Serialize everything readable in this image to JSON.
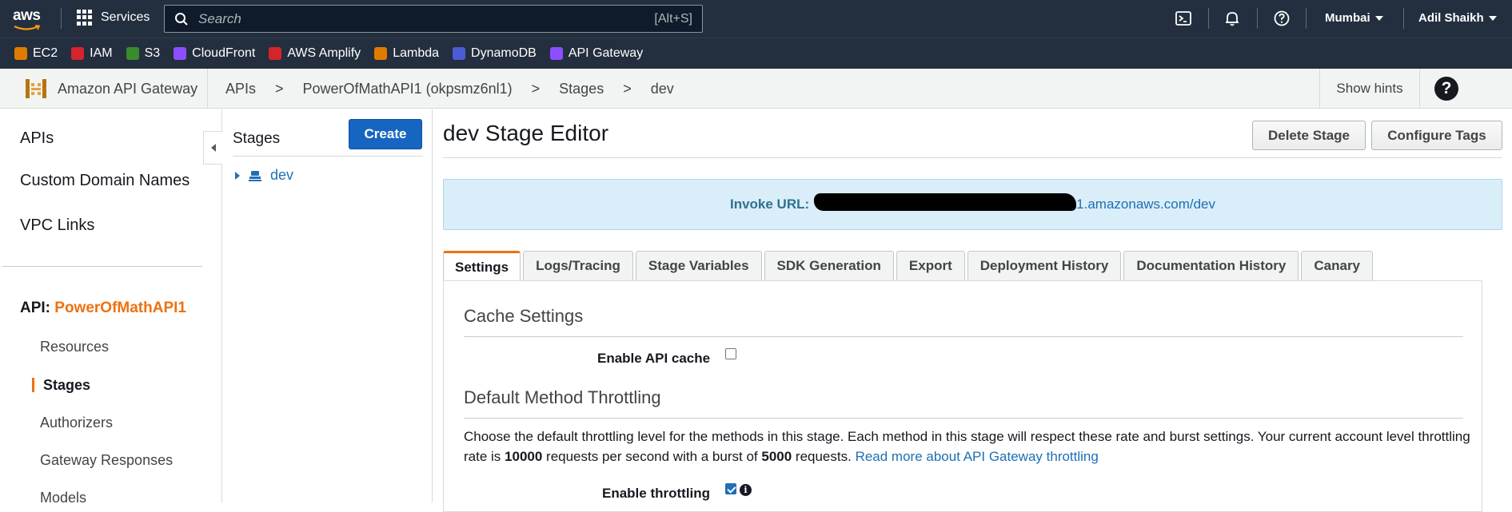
{
  "topbar": {
    "logo_text": "aws",
    "services_label": "Services",
    "search_placeholder": "Search",
    "search_shortcut": "[Alt+S]",
    "region": "Mumbai",
    "user": "Adil Shaikh"
  },
  "favorites": [
    {
      "label": "EC2",
      "color": "#e07b00",
      "icon": "ec2-icon"
    },
    {
      "label": "IAM",
      "color": "#d6242d",
      "icon": "iam-icon"
    },
    {
      "label": "S3",
      "color": "#3a8a2e",
      "icon": "s3-icon"
    },
    {
      "label": "CloudFront",
      "color": "#8c4fff",
      "icon": "cloudfront-icon"
    },
    {
      "label": "AWS Amplify",
      "color": "#d6242d",
      "icon": "amplify-icon"
    },
    {
      "label": "Lambda",
      "color": "#e07b00",
      "icon": "lambda-icon"
    },
    {
      "label": "DynamoDB",
      "color": "#4d5bd6",
      "icon": "dynamodb-icon"
    },
    {
      "label": "API Gateway",
      "color": "#8c4fff",
      "icon": "api-gateway-icon"
    }
  ],
  "service_header": {
    "name": "Amazon API Gateway",
    "breadcrumb": [
      "APIs",
      ">",
      "PowerOfMathAPI1 (okpsmz6nl1)",
      ">",
      "Stages",
      ">",
      "dev"
    ],
    "hints": "Show hints",
    "help": "?"
  },
  "leftnav": {
    "items": [
      "APIs",
      "Custom Domain Names",
      "VPC Links"
    ],
    "api_prefix": "API:",
    "api_name": "PowerOfMathAPI1",
    "sub_items": [
      "Resources",
      "Stages",
      "Authorizers",
      "Gateway Responses",
      "Models"
    ]
  },
  "stages_panel": {
    "title": "Stages",
    "create": "Create",
    "tree": [
      {
        "label": "dev"
      }
    ]
  },
  "editor": {
    "title": "dev Stage Editor",
    "delete_stage": "Delete Stage",
    "configure_tags": "Configure Tags",
    "invoke_label": "Invoke URL:",
    "invoke_url_visible": "1.amazonaws.com/dev",
    "tabs": [
      "Settings",
      "Logs/Tracing",
      "Stage Variables",
      "SDK Generation",
      "Export",
      "Deployment History",
      "Documentation History",
      "Canary"
    ],
    "active_tab": "Settings",
    "cache_title": "Cache Settings",
    "enable_cache_label": "Enable API cache",
    "enable_cache": false,
    "throttle_title": "Default Method Throttling",
    "throttle_desc_1": "Choose the default throttling level for the methods in this stage. Each method in this stage will respect these rate and burst settings. Your current account level throttling rate is ",
    "rate": "10000",
    "throttle_desc_2": " requests per second with a burst of ",
    "burst": "5000",
    "throttle_desc_3": " requests. ",
    "throttle_link": "Read more about API Gateway throttling",
    "enable_throttle_label": "Enable throttling",
    "enable_throttle": true
  }
}
